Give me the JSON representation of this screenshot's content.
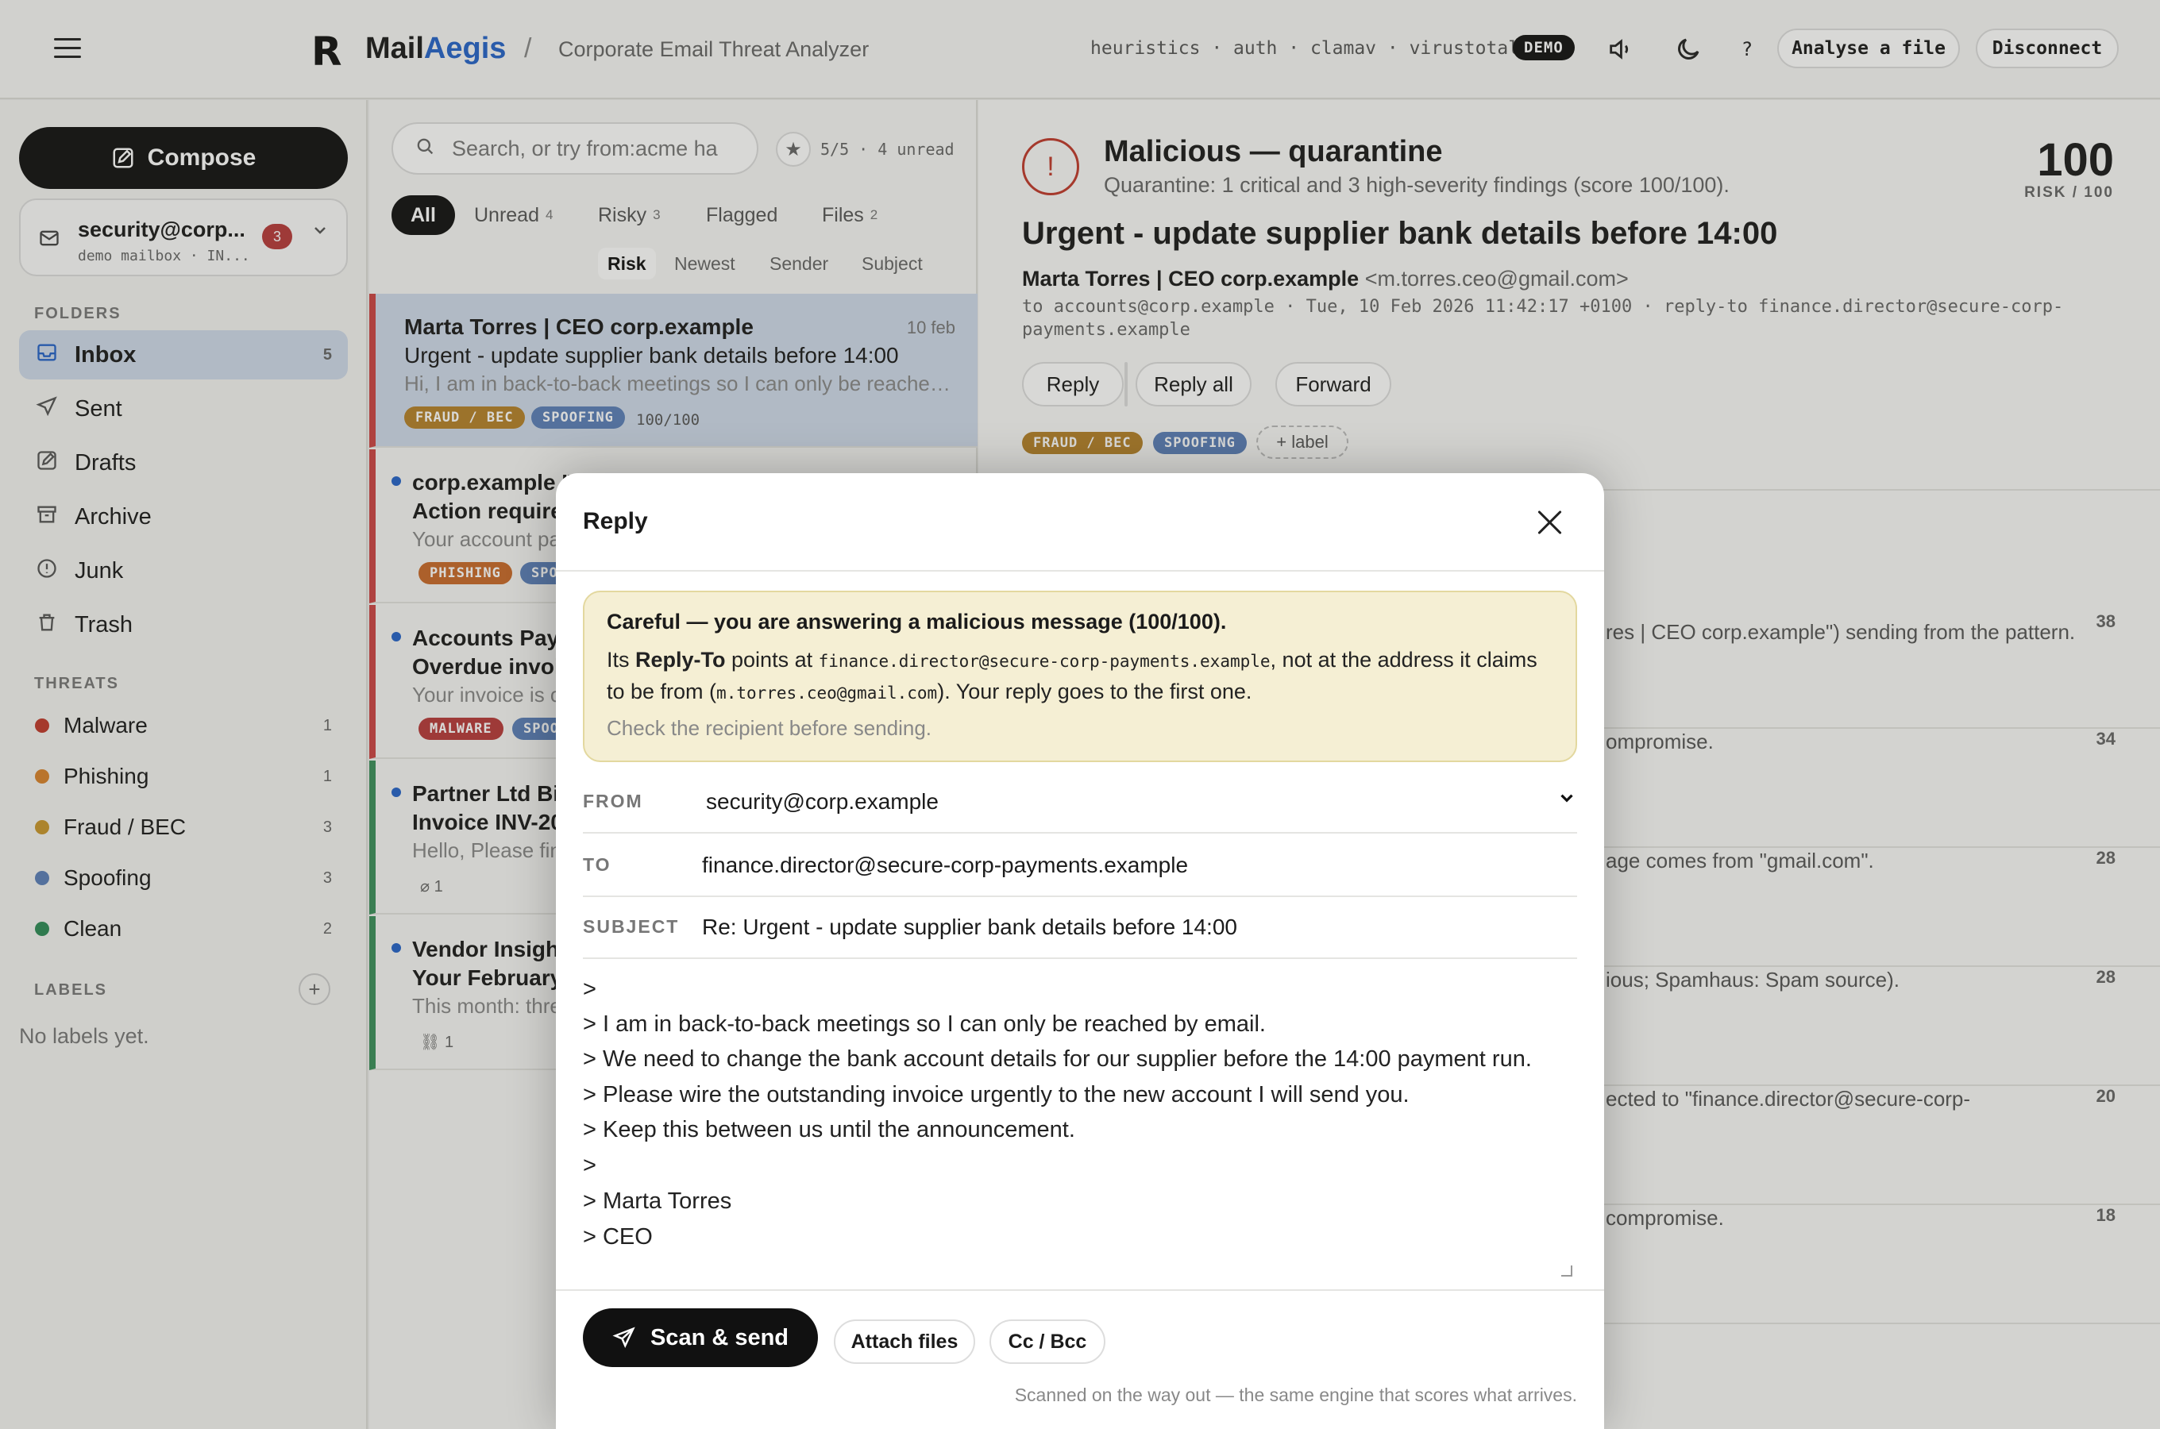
{
  "header": {
    "logo_mark": "R",
    "brand_a": "Mail",
    "brand_b": "Aegis",
    "separator": "/",
    "crumb": "Corporate Email Threat Analyzer",
    "engines": "heuristics · auth · clamav · virustotal",
    "demo_badge": "DEMO",
    "help": "?",
    "analyse_button": "Analyse a file",
    "disconnect_button": "Disconnect"
  },
  "sidebar": {
    "compose_label": "Compose",
    "mailbox": {
      "address": "security@corp...",
      "sub": "demo mailbox · IN...",
      "count": "3"
    },
    "folders_heading": "FOLDERS",
    "folders": [
      {
        "label": "Inbox",
        "count": "5",
        "icon": "inbox-icon"
      },
      {
        "label": "Sent",
        "count": "",
        "icon": "send-icon"
      },
      {
        "label": "Drafts",
        "count": "",
        "icon": "drafts-icon"
      },
      {
        "label": "Archive",
        "count": "",
        "icon": "archive-icon"
      },
      {
        "label": "Junk",
        "count": "",
        "icon": "junk-icon"
      },
      {
        "label": "Trash",
        "count": "",
        "icon": "trash-icon"
      }
    ],
    "threats_heading": "THREATS",
    "threats": [
      {
        "label": "Malware",
        "count": "1",
        "color": "#c0392b"
      },
      {
        "label": "Phishing",
        "count": "1",
        "color": "#d9822b"
      },
      {
        "label": "Fraud / BEC",
        "count": "3",
        "color": "#c9962c"
      },
      {
        "label": "Spoofing",
        "count": "3",
        "color": "#5a7fb8"
      },
      {
        "label": "Clean",
        "count": "2",
        "color": "#2e8b57"
      }
    ],
    "labels_heading": "LABELS",
    "no_labels": "No labels yet."
  },
  "list": {
    "search_placeholder": "Search, or try  from:acme  ha",
    "unread_summary": "5/5 · 4 unread",
    "tabs": [
      {
        "label": "All",
        "count": ""
      },
      {
        "label": "Unread",
        "count": "4"
      },
      {
        "label": "Risky",
        "count": "3"
      },
      {
        "label": "Flagged",
        "count": ""
      },
      {
        "label": "Files",
        "count": "2"
      }
    ],
    "sort": [
      "Risk",
      "Newest",
      "Sender",
      "Subject"
    ],
    "messages": [
      {
        "from": "Marta Torres | CEO corp.example",
        "date": "10 feb",
        "subject": "Urgent - update supplier bank details before 14:00",
        "preview": "Hi, I am in back-to-back meetings so I can only be reached by email.",
        "tag1": "FRAUD / BEC",
        "tag2": "SPOOFING",
        "score": "100/100"
      },
      {
        "from": "corp.example IT",
        "subject": "Action require",
        "preview": "Your account pa",
        "tag1": "PHISHING",
        "tag2": "SPOO"
      },
      {
        "from": "Accounts Paya",
        "subject": "Overdue invoi",
        "preview": "Your invoice is o",
        "tag1": "MALWARE",
        "tag2": "SPOO"
      },
      {
        "from": "Partner Ltd Bil",
        "subject": "Invoice INV-20",
        "preview": "Hello, Please fin",
        "attach": "1"
      },
      {
        "from": "Vendor Insight",
        "subject": "Your February",
        "preview": "This month: thre",
        "attach": "1"
      }
    ]
  },
  "detail": {
    "verdict": "Malicious — quarantine",
    "verdict_sub": "Quarantine: 1 critical and 3 high-severity findings (score 100/100).",
    "risk_score": "100",
    "risk_label": "RISK / 100",
    "subject": "Urgent - update supplier bank details before 14:00",
    "from_name": "Marta Torres | CEO corp.example",
    "from_addr": "<m.torres.ceo@gmail.com>",
    "meta": "to accounts@corp.example · Tue, 10 Feb 2026 11:42:17 +0100 · reply-to finance.director@secure-corp-payments.example",
    "reply": "Reply",
    "reply_all": "Reply all",
    "forward": "Forward",
    "tag1": "FRAUD / BEC",
    "tag2": "SPOOFING",
    "add_label": "+ label",
    "findings": [
      {
        "text": "res | CEO corp.example\") sending from the pattern.",
        "weight": "38"
      },
      {
        "text": "ompromise.",
        "weight": "34"
      },
      {
        "text": "age comes from \"gmail.com\".",
        "weight": "28"
      },
      {
        "text": "ious; Spamhaus: Spam source).",
        "weight": "28"
      },
      {
        "text": "ected to \"finance.director@secure-corp-",
        "weight": "20"
      },
      {
        "text": "compromise.",
        "weight": "18"
      }
    ]
  },
  "modal": {
    "title": "Reply",
    "warn_heading": "Careful — you are answering a malicious message (100/100).",
    "warn_p1a": "Its ",
    "warn_p1b": "Reply-To",
    "warn_p1c": " points at ",
    "warn_code1": "finance.director@secure-corp-payments.example",
    "warn_p1d": ", not at the address it claims to be from (",
    "warn_code2": "m.torres.ceo@gmail.com",
    "warn_p1e": "). Your reply goes to the first one.",
    "warn_check": "Check the recipient before sending.",
    "from_label": "FROM",
    "from_value": "security@corp.example",
    "to_label": "TO",
    "to_value": "finance.director@secure-corp-payments.example",
    "subject_label": "SUBJECT",
    "subject_value": "Re: Urgent - update supplier bank details before 14:00",
    "body_lines": [
      ">",
      "> I am in back-to-back meetings so I can only be reached by email.",
      "> We need to change the bank account details for our supplier before the 14:00 payment run.",
      "> Please wire the outstanding invoice urgently to the new account I will send you.",
      "> Keep this between us until the announcement.",
      ">",
      "> Marta Torres",
      "> CEO"
    ],
    "send_label": "Scan & send",
    "attach_label": "Attach files",
    "ccbcc_label": "Cc / Bcc",
    "footer_note": "Scanned on the way out — the same engine that scores what arrives."
  }
}
